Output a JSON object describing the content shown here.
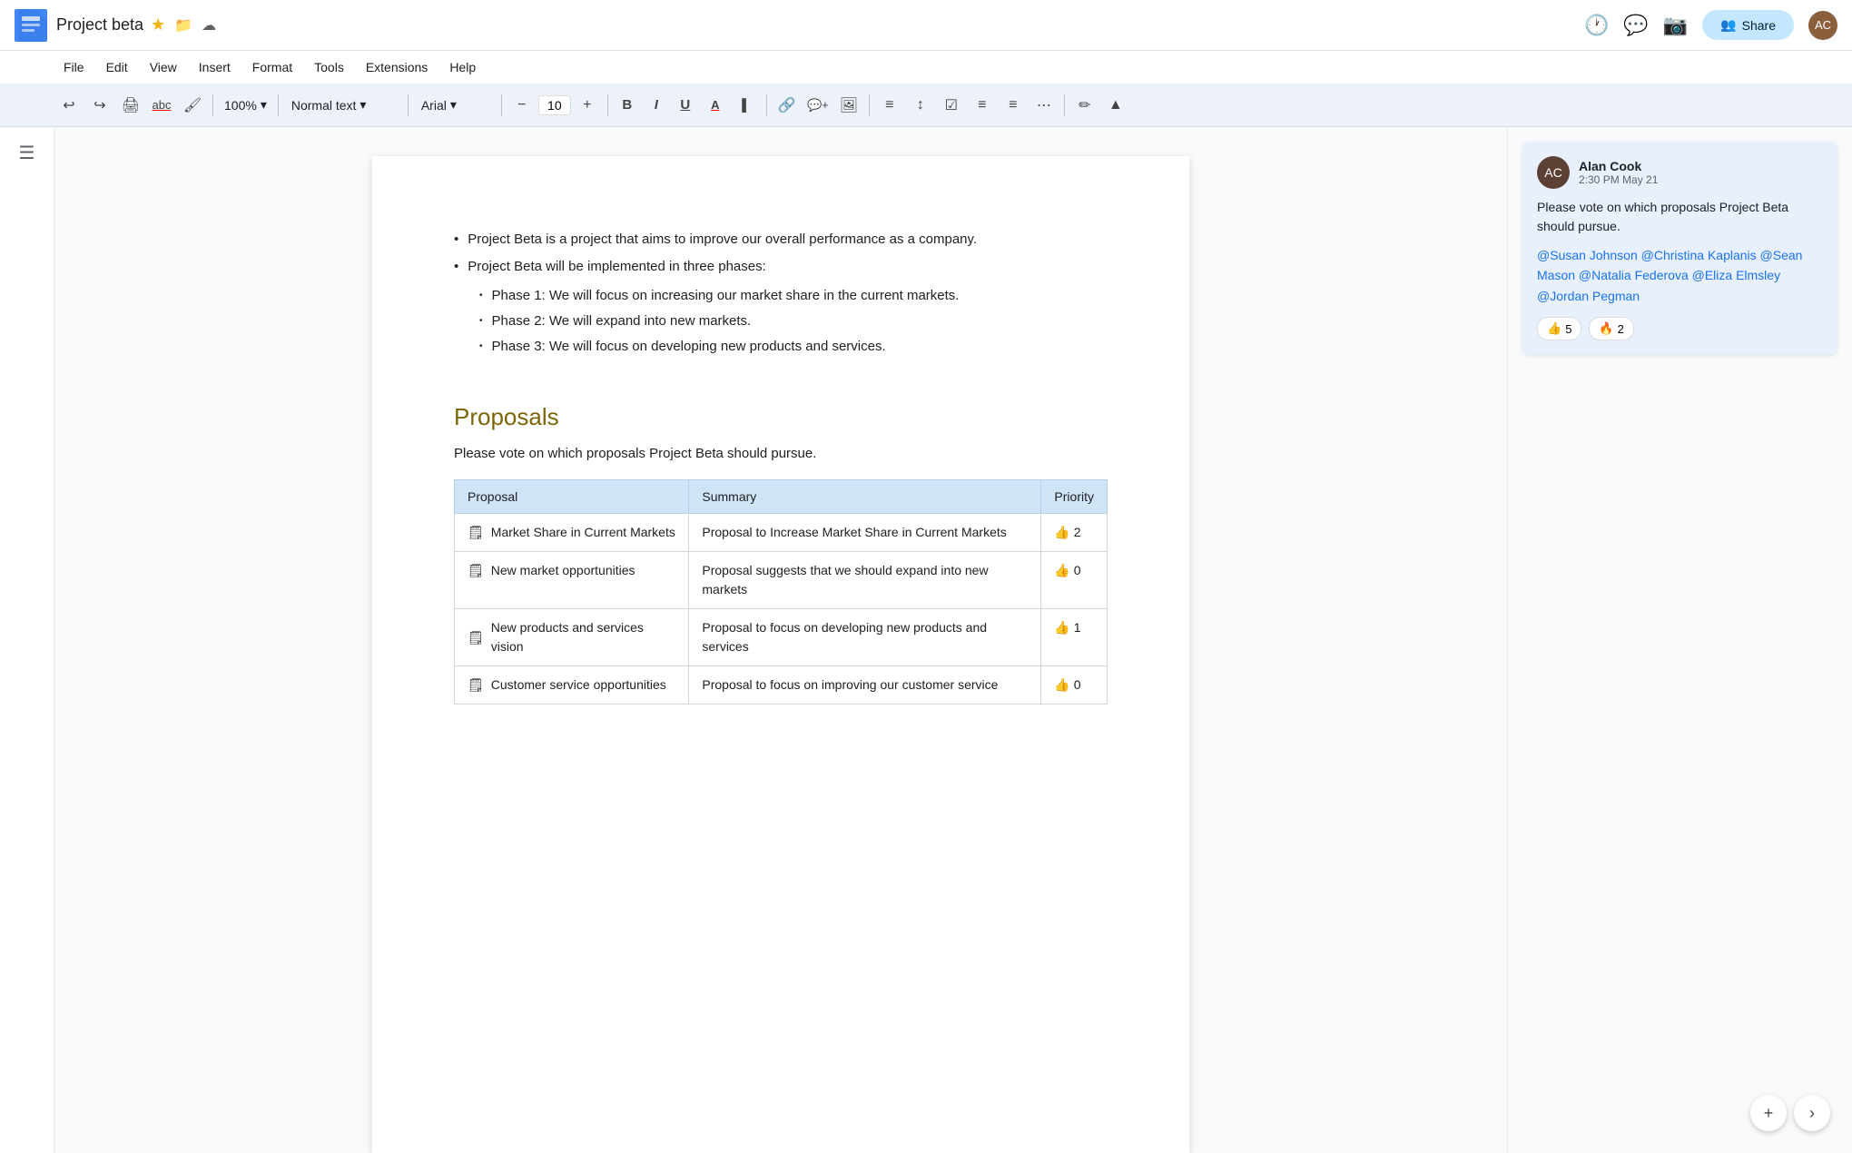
{
  "titleBar": {
    "docTitle": "Project beta",
    "starIcon": "★",
    "folderIcon": "🗂",
    "cloudIcon": "☁",
    "shareLabel": "Share"
  },
  "menuBar": {
    "items": [
      "File",
      "Edit",
      "View",
      "Insert",
      "Format",
      "Tools",
      "Extensions",
      "Help"
    ]
  },
  "toolbar": {
    "zoom": "100%",
    "zoomDropdown": "▾",
    "styleLabel": "Normal text",
    "styleDropdown": "▾",
    "fontLabel": "Arial",
    "fontDropdown": "▾",
    "fontSize": "10",
    "boldLabel": "B",
    "italicLabel": "I",
    "underlineLabel": "U"
  },
  "document": {
    "bullets": [
      "Project Beta is a project that aims to improve our overall performance as a company.",
      "Project Beta will be implemented in three phases:"
    ],
    "subBullets": [
      "Phase 1: We will focus on increasing our market share in the current markets.",
      "Phase 2: We will expand into new markets.",
      "Phase 3: We will focus on developing new products and services."
    ],
    "proposalsHeading": "Proposals",
    "proposalsDesc": "Please vote on which proposals Project Beta should pursue.",
    "tableHeaders": [
      "Proposal",
      "Summary",
      "Priority"
    ],
    "tableRows": [
      {
        "proposal": "Market Share in Current Markets",
        "summary": "Proposal to Increase Market Share in Current Markets",
        "priority": "👍 2",
        "icon": "🗒"
      },
      {
        "proposal": "New market opportunities",
        "summary": "Proposal suggests that we should expand into new markets",
        "priority": "👍 0",
        "icon": "🗒"
      },
      {
        "proposal": "New products and services vision",
        "summary": "Proposal to focus on developing new products and services",
        "priority": "👍 1",
        "icon": "🗒"
      },
      {
        "proposal": "Customer service opportunities",
        "summary": "Proposal to focus on improving our customer service",
        "priority": "👍 0",
        "icon": "🗒"
      }
    ]
  },
  "comment": {
    "author": "Alan Cook",
    "time": "2:30 PM May 21",
    "text": "Please vote on which proposals Project Beta should pursue.",
    "mentions": "@Susan Johnson @Christina Kaplanis @Sean Mason @Natalia Federova @Eliza Elmsley @Jordan Pegman",
    "reactions": [
      {
        "emoji": "👍",
        "count": "5"
      },
      {
        "emoji": "🔥",
        "count": "2"
      }
    ]
  },
  "fab": {
    "addIcon": "+",
    "arrowIcon": "›"
  }
}
